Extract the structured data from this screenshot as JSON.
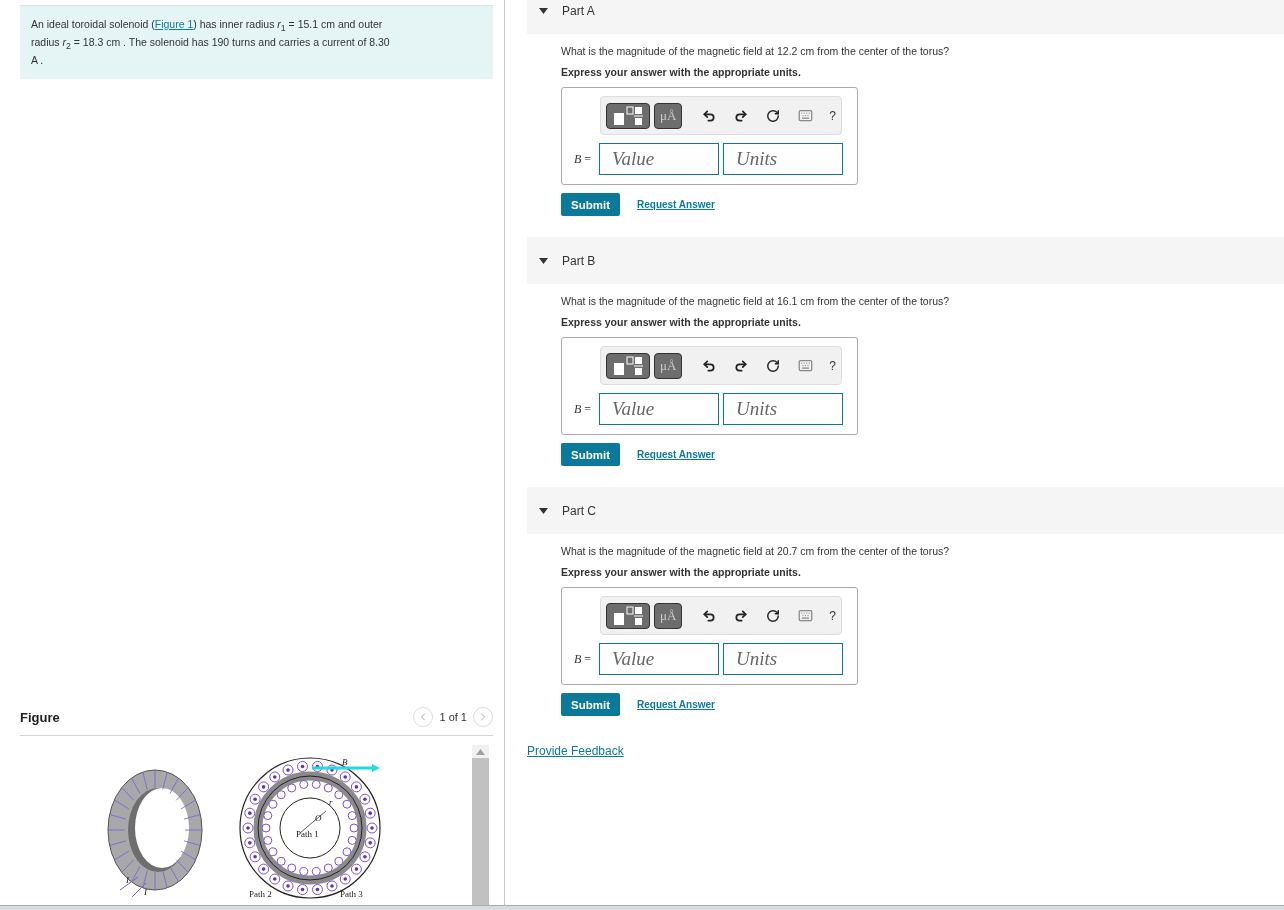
{
  "problem": {
    "before": "An ideal toroidal solenoid (",
    "link": "Figure 1",
    "after": ") has inner radius *r*$_{1}$ = 15.1  cm and outer radius *r*$_{2}$ = 18.3  cm . The solenoid has 190 turns and carries a current of 8.30  A ."
  },
  "figure": {
    "title": "Figure",
    "pager": "1 of 1",
    "labels": [
      "O",
      "r",
      "B",
      "I",
      "I",
      "Path 1",
      "Path 2",
      "Path 3"
    ]
  },
  "parts": [
    {
      "title": "Part A",
      "expanded": true,
      "question": "What is the magnitude of the magnetic field at 12.2  cm from the center of the torus?",
      "instruction": "Express your answer with the appropriate units.",
      "units_button": "μÅ",
      "help": "?",
      "variable": "*B* =",
      "value_placeholder": "Value",
      "units_placeholder": "Units",
      "submit": "Submit",
      "request": "Request Answer"
    },
    {
      "title": "Part B",
      "expanded": true,
      "question": "What is the magnitude of the magnetic field at 16.1  cm from the center of the torus?",
      "instruction": "Express your answer with the appropriate units.",
      "units_button": "μÅ",
      "help": "?",
      "variable": "*B* =",
      "value_placeholder": "Value",
      "units_placeholder": "Units",
      "submit": "Submit",
      "request": "Request Answer"
    },
    {
      "title": "Part C",
      "expanded": true,
      "question": "What is the magnitude of the magnetic field at 20.7  cm from the center of the torus?",
      "instruction": "Express your answer with the appropriate units.",
      "units_button": "μÅ",
      "help": "?",
      "variable": "*B* =",
      "value_placeholder": "Value",
      "units_placeholder": "Units",
      "submit": "Submit",
      "request": "Request Answer"
    }
  ],
  "feedback": "Provide Feedback"
}
